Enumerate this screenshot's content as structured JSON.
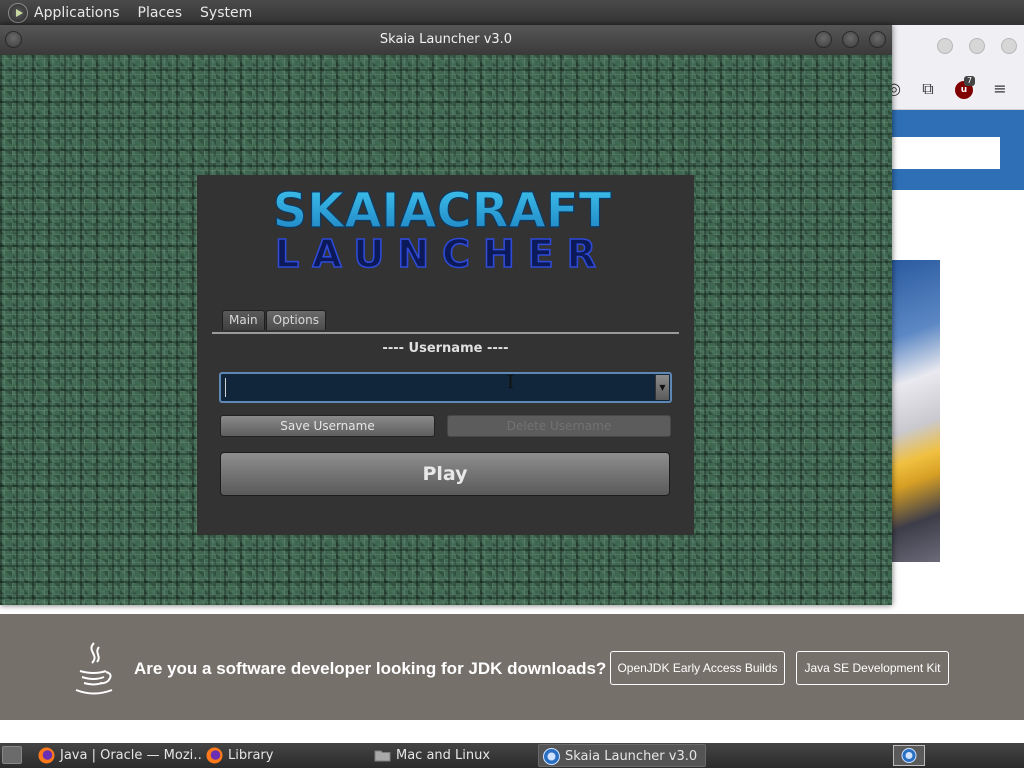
{
  "top_panel": {
    "menus": [
      "Applications",
      "Places",
      "System"
    ]
  },
  "launcher": {
    "title": "Skaia Launcher v3.0",
    "logo_line1": "SKAIACRAFT",
    "logo_line2": "LAUNCHER",
    "tabs": [
      {
        "label": "Main",
        "active": true
      },
      {
        "label": "Options",
        "active": false
      }
    ],
    "username_label": "---- Username ----",
    "username_value": "",
    "save_label": "Save Username",
    "delete_label": "Delete Username",
    "play_label": "Play"
  },
  "banner": {
    "headline": "Are you a software developer looking for JDK downloads?",
    "button1": "OpenJDK Early Access Builds",
    "button2": "Java SE Development Kit"
  },
  "browser_toolbar": {
    "ublock_badge": "7"
  },
  "taskbar": {
    "tasks": [
      {
        "label": "Java | Oracle — Mozi…",
        "icon": "firefox-icon"
      },
      {
        "label": "Library",
        "icon": "firefox-icon"
      },
      {
        "label": "Mac and Linux",
        "icon": "folder-icon"
      },
      {
        "label": "Skaia Launcher v3.0",
        "icon": "java-app-icon",
        "active": true
      }
    ]
  },
  "colors": {
    "accent_focus": "#5f87b3",
    "launcher_panel": "#333333",
    "banner_bg": "#76706b",
    "browser_blue": "#2f6fb5"
  }
}
